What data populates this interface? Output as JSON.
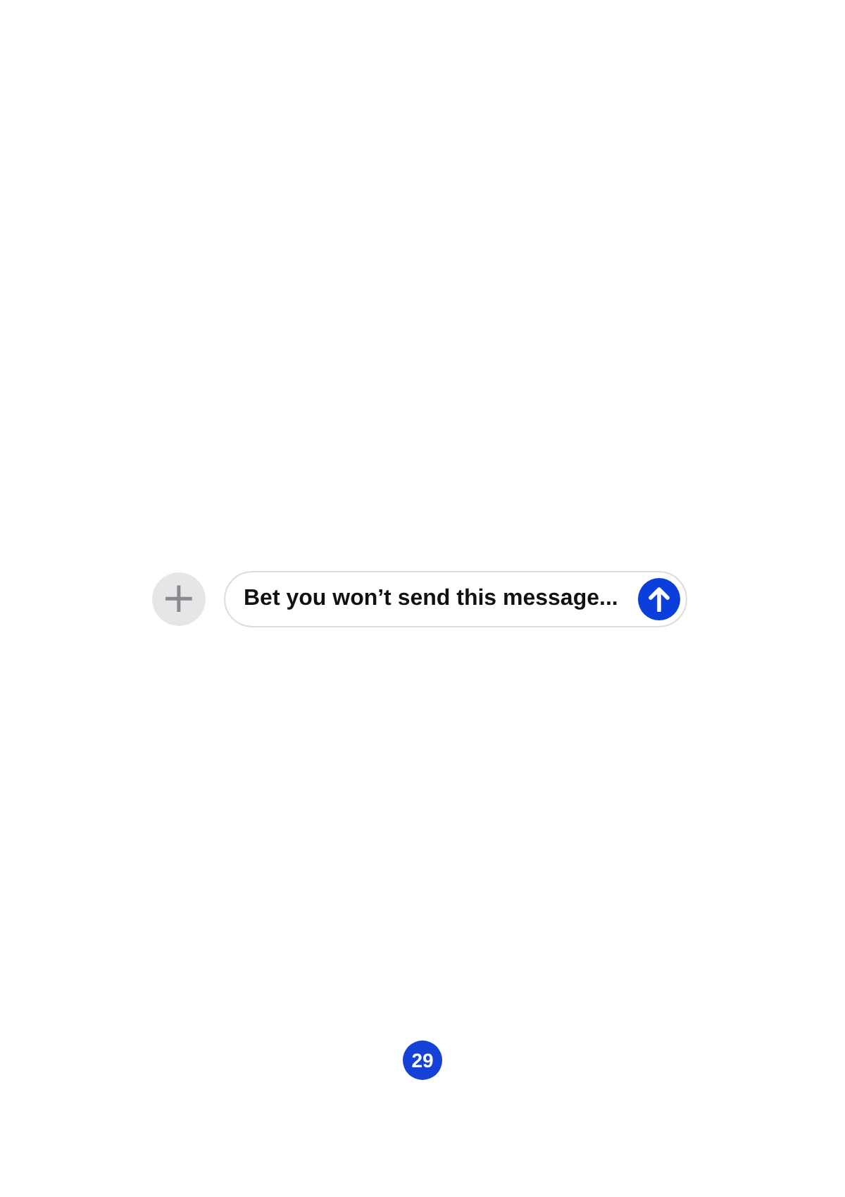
{
  "composer": {
    "add_button": "+",
    "message": "Bet you won’t send this message..."
  },
  "page_number": "29"
}
